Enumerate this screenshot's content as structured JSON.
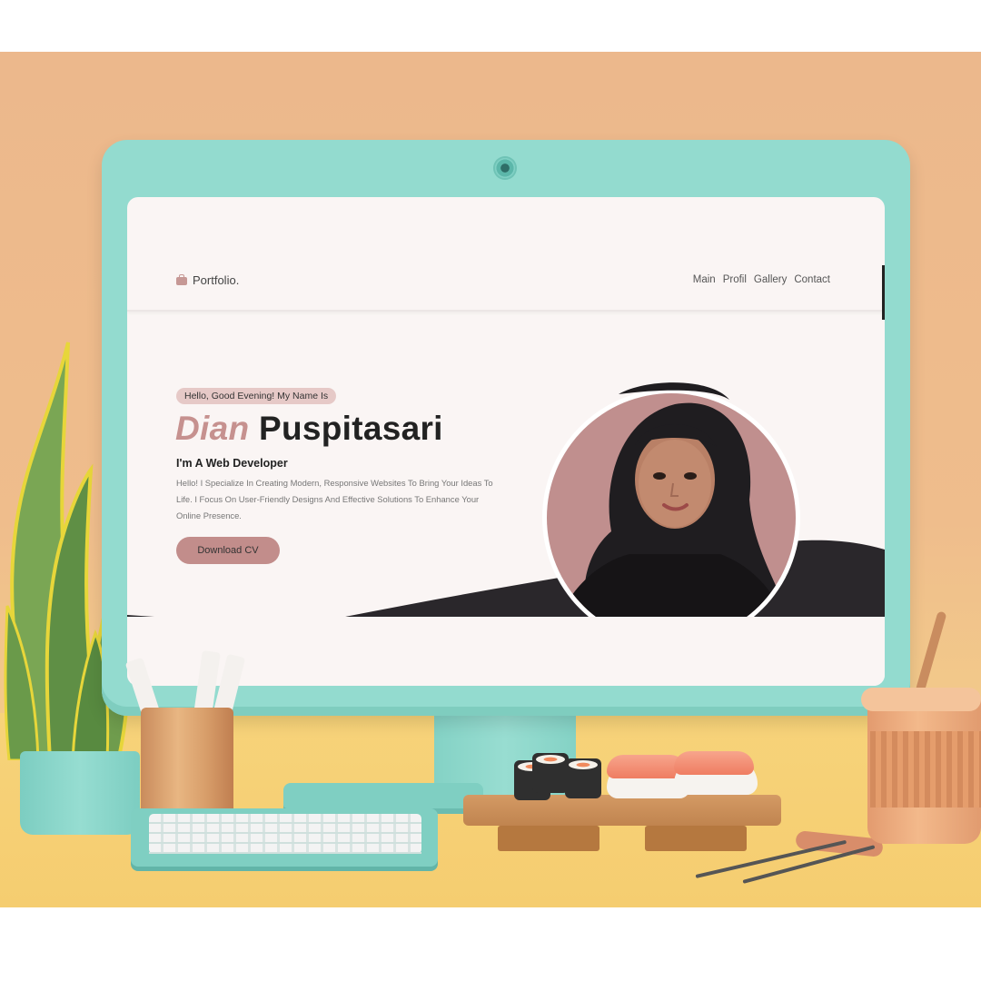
{
  "portfolio": {
    "logo_text": "Portfolio.",
    "logo_icon": "briefcase-icon",
    "nav_links": [
      "Main",
      "Profil",
      "Gallery",
      "Contact"
    ],
    "greeting": "Hello, Good Evening! My Name Is",
    "first_name": "Dian",
    "last_name": "Puspitasari",
    "role": "I'm A Web Developer",
    "bio": "Hello! I Specialize In Creating Modern, Responsive Websites To Bring Your Ideas To Life. I Focus On User-Friendly Designs And Effective Solutions To Enhance Your Online Presence.",
    "cta_label": "Download CV"
  },
  "colors": {
    "accent": "#c6918f",
    "button": "#c28d8b",
    "dark": "#222222",
    "monitor": "#93dbcf",
    "background": "#ecb88c"
  }
}
